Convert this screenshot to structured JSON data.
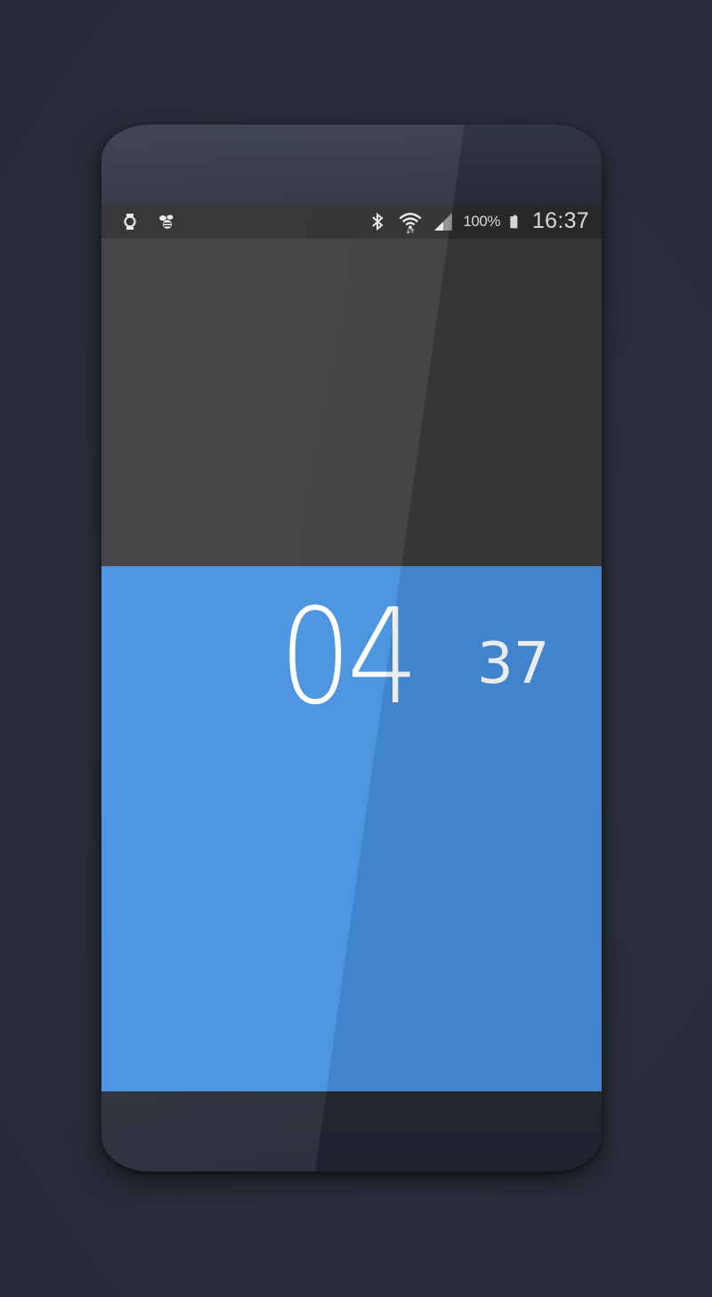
{
  "status_bar": {
    "left_icons": [
      "watch-icon",
      "bee-icon"
    ],
    "right_icons": [
      "bluetooth-icon",
      "wifi-icon",
      "signal-icon",
      "battery-icon"
    ],
    "battery_percent": "100%",
    "time": "16:37"
  },
  "clock": {
    "hours": "04",
    "minutes": "37"
  },
  "colors": {
    "background": "#2b2f3c",
    "status_bar": "#2b2c2e",
    "top_panel": "#3a3b3d",
    "bottom_panel": "#4590de",
    "clock_text": "#ffffff"
  }
}
